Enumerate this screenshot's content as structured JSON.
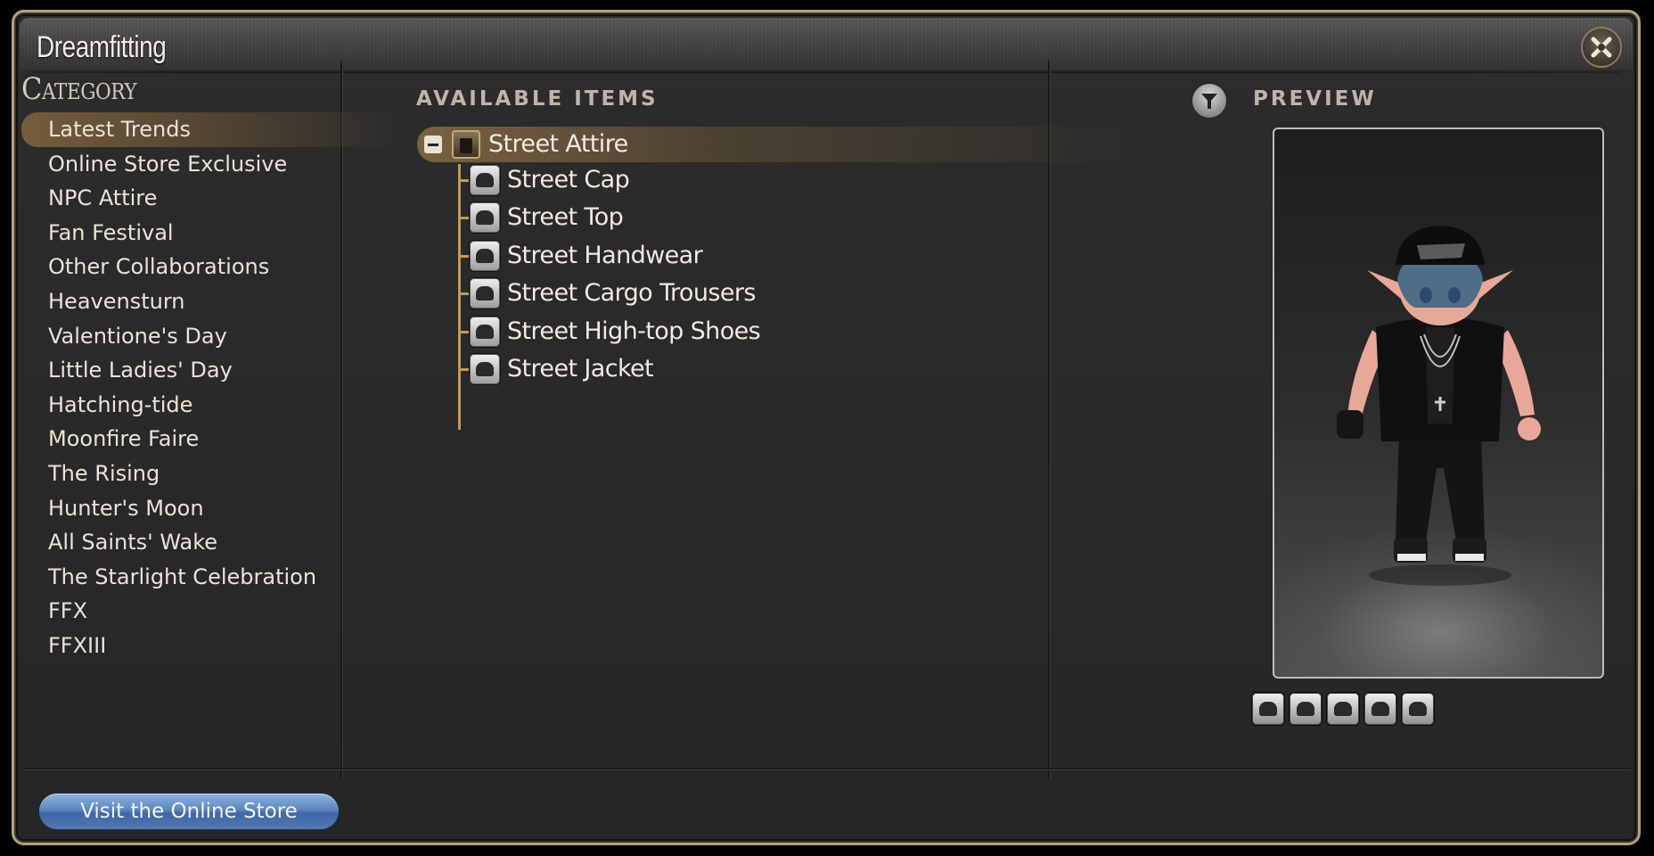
{
  "window": {
    "title": "Dreamfitting"
  },
  "category": {
    "heading": "Category",
    "items": [
      {
        "label": "Latest Trends",
        "selected": true
      },
      {
        "label": "Online Store Exclusive"
      },
      {
        "label": "NPC Attire"
      },
      {
        "label": "Fan Festival"
      },
      {
        "label": "Other Collaborations"
      },
      {
        "label": "Heavensturn"
      },
      {
        "label": "Valentione's Day"
      },
      {
        "label": "Little Ladies' Day"
      },
      {
        "label": "Hatching-tide"
      },
      {
        "label": "Moonfire Faire"
      },
      {
        "label": "The Rising"
      },
      {
        "label": "Hunter's Moon"
      },
      {
        "label": "All Saints' Wake"
      },
      {
        "label": "The Starlight Celebration"
      },
      {
        "label": "FFX"
      },
      {
        "label": "FFXIII"
      }
    ]
  },
  "items": {
    "heading": "AVAILABLE ITEMS",
    "group": {
      "label": "Street Attire",
      "expanded": true,
      "icon": "bag-icon"
    },
    "children": [
      {
        "label": "Street Cap",
        "icon": "cap-icon"
      },
      {
        "label": "Street Top",
        "icon": "top-icon"
      },
      {
        "label": "Street Handwear",
        "icon": "handwear-icon"
      },
      {
        "label": "Street Cargo Trousers",
        "icon": "trousers-icon"
      },
      {
        "label": "Street High-top Shoes",
        "icon": "shoes-icon"
      },
      {
        "label": "Street Jacket",
        "icon": "jacket-icon"
      }
    ]
  },
  "preview": {
    "heading": "PREVIEW",
    "slots": [
      "cap-icon",
      "top-icon",
      "handwear-icon",
      "trousers-icon",
      "shoes-icon"
    ]
  },
  "footer": {
    "store_button": "Visit the Online Store"
  },
  "colors": {
    "frame_gold": "#b8a27a",
    "tree_line": "#c39a55",
    "button_blue": "#5d86c0"
  }
}
